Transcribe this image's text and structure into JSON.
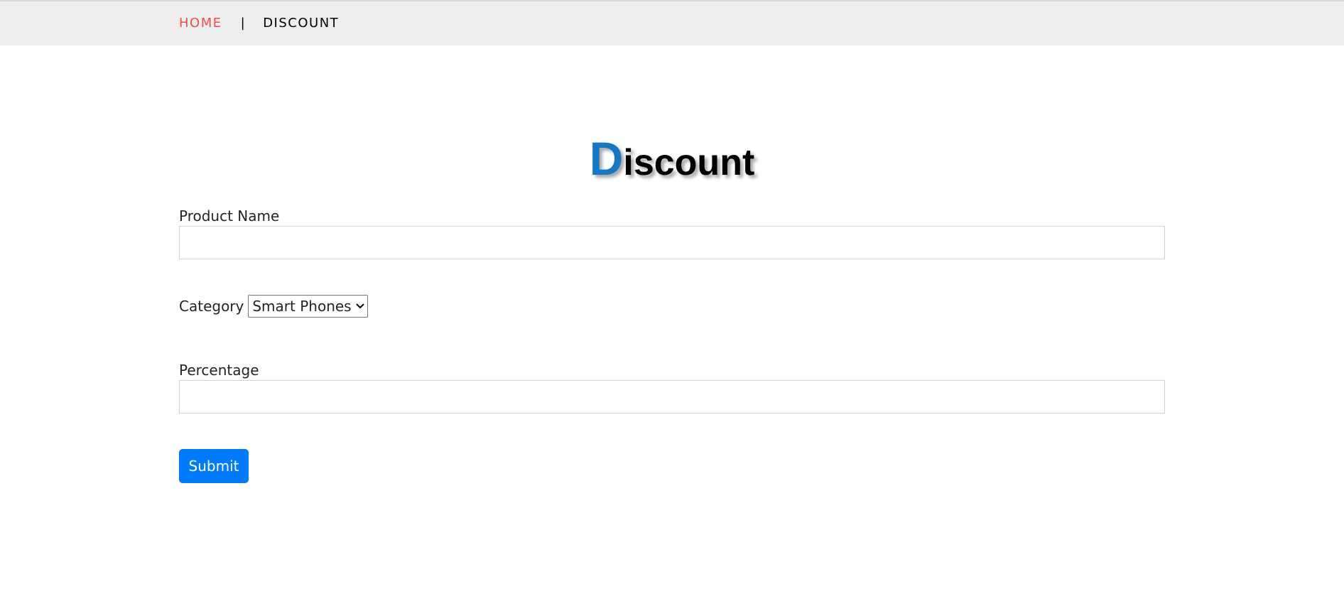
{
  "nav": {
    "home_label": "HOME",
    "separator": "|",
    "discount_label": "DISCOUNT"
  },
  "page": {
    "title_first_letter": "D",
    "title_rest": "iscount"
  },
  "form": {
    "product_name_label": "Product Name",
    "product_name_value": "",
    "category_label": "Category",
    "category_selected": "Smart Phones",
    "percentage_label": "Percentage",
    "percentage_value": "",
    "submit_label": "Submit"
  },
  "colors": {
    "home_link": "#f04e4e",
    "title_accent": "#1379c6",
    "submit_button": "#007bff",
    "nav_background": "#eeeeee"
  },
  "icons": {
    "select_chevron": "chevron-down-icon"
  }
}
